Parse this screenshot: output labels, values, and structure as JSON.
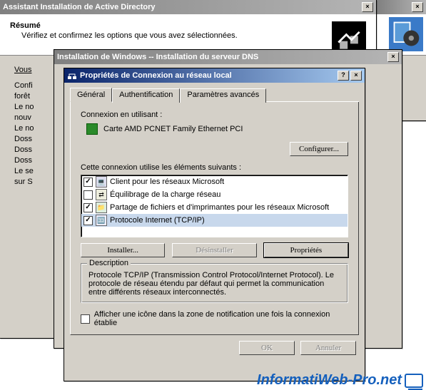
{
  "win_ad": {
    "title": "Assistant Installation de Active Directory",
    "banner_title": "Résumé",
    "banner_sub": "Vérifiez et confirmez les options que vous avez sélectionnées.",
    "body_intro": "Vous",
    "lines": [
      "Confi",
      "forêt",
      "",
      "Le no",
      "nouv",
      "",
      "Le no",
      "",
      "Doss",
      "Doss",
      "Doss",
      "",
      "Le se",
      "",
      "sur S"
    ]
  },
  "win_dns": {
    "title": "Installation de Windows -- Installation du serveur DNS"
  },
  "win_prop": {
    "title": "Propriétés de Connexion au réseau local",
    "tabs": {
      "general": "Général",
      "auth": "Authentification",
      "advanced": "Paramètres avancés"
    },
    "conn_using_label": "Connexion en utilisant :",
    "adapter_name": "Carte AMD PCNET Family Ethernet PCI",
    "configure_btn": "Configurer...",
    "uses_label": "Cette connexion utilise les éléments suivants :",
    "items": [
      {
        "checked": true,
        "icon": "client",
        "label": "Client pour les réseaux Microsoft"
      },
      {
        "checked": false,
        "icon": "nlb",
        "label": "Équilibrage de la charge réseau"
      },
      {
        "checked": true,
        "icon": "share",
        "label": "Partage de fichiers et d'imprimantes pour les réseaux Microsoft"
      },
      {
        "checked": true,
        "icon": "tcpip",
        "label": "Protocole Internet (TCP/IP)",
        "selected": true
      }
    ],
    "install_btn": "Installer...",
    "uninstall_btn": "Désinstaller",
    "properties_btn": "Propriétés",
    "desc_legend": "Description",
    "desc_text": "Protocole TCP/IP (Transmission Control Protocol/Internet Protocol). Le protocole de réseau étendu par défaut qui permet la communication entre différents réseaux interconnectés.",
    "tray_checkbox": "Afficher une icône dans la zone de notification une fois la connexion établie",
    "ok_btn": "OK",
    "cancel_btn": "Annuler"
  },
  "watermark": "InformatiWeb-Pro.net"
}
